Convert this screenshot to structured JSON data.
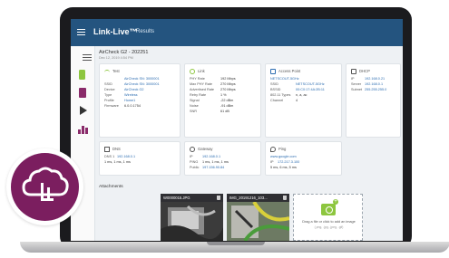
{
  "header": {
    "app_title": "Link-Live™",
    "section": "Results"
  },
  "test": {
    "title": "AirCheck G2 - 202251",
    "date": "Dec 12, 2019 4:54 PM"
  },
  "cards": {
    "test": {
      "title": "Test",
      "rows": [
        {
          "label": "",
          "value": "AirCheck SN: 3000001"
        },
        {
          "label": "SSID",
          "value": "AirCheck SN: 3000001"
        },
        {
          "label": "Device",
          "value": "AirCheck G2"
        },
        {
          "label": "Type",
          "value": "Wireless"
        },
        {
          "label": "Profile",
          "value": "Home1"
        },
        {
          "label": "Firmware",
          "value": "6.0.0.1754"
        }
      ]
    },
    "link": {
      "title": "Link",
      "rows": [
        {
          "label": "PHY Rate",
          "value": "192 Mbps"
        },
        {
          "label": "Max PHY Rate",
          "value": "270 Mbps"
        },
        {
          "label": "Advertised Rate",
          "value": "270 Mbps"
        },
        {
          "label": "Retry Rate",
          "value": "1 %"
        },
        {
          "label": "Signal",
          "value": "-22 dBm"
        },
        {
          "label": "Noise",
          "value": "-91 dBm"
        },
        {
          "label": "SNR",
          "value": "61 dB"
        }
      ]
    },
    "access_point": {
      "title": "Access Point",
      "rows": [
        {
          "label": "",
          "value": "NETSCOUT-5GHz"
        },
        {
          "label": "SSID",
          "value": "NETSCOUT-5GHz"
        },
        {
          "label": "BSSID",
          "value": "00:C0:17:4A:2B:11"
        },
        {
          "label": "802.11 Types",
          "value": "n, a, ac"
        },
        {
          "label": "Channel",
          "value": "4"
        }
      ]
    },
    "dhcp": {
      "title": "DHCP",
      "rows": [
        {
          "label": "IP",
          "value": "192.168.0.21"
        },
        {
          "label": "Server",
          "value": "192.168.0.1"
        },
        {
          "label": "Subnet",
          "value": "255.255.255.0"
        }
      ]
    },
    "dns": {
      "title": "DNS",
      "rows": [
        {
          "label": "DNS 1",
          "value": "192.168.0.1"
        },
        {
          "label": "",
          "value": "1 ms, 1 ms, 1 ms"
        }
      ]
    },
    "gateway": {
      "title": "Gateway",
      "rows": [
        {
          "label": "IP",
          "value": "192.168.0.1"
        },
        {
          "label": "PING",
          "value": "1 ms, 1 ms, 1 ms"
        },
        {
          "label": "Public",
          "value": "197.156.90.84"
        }
      ]
    },
    "ping": {
      "title": "Ping",
      "rows": [
        {
          "label": "",
          "value": "www.google.com"
        },
        {
          "label": "IP",
          "value": "172.217.3.100"
        },
        {
          "label": "",
          "value": "5 ms, 6 ms, 5 ms"
        }
      ]
    }
  },
  "attachments": {
    "title": "Attachments",
    "items": [
      {
        "name": "W0000015.JPG"
      },
      {
        "name": "IMG_20191216_103..."
      }
    ],
    "upload_text": "Drag a file or click to add an image",
    "upload_sub": "(.png, .jpg, .jpeg, .gif)"
  },
  "colors": {
    "header": "#24547f",
    "accent_green": "#8dc63f",
    "brand_purple": "#7b1e5f"
  },
  "icons": [
    "menu-icon",
    "list-icon",
    "phone-icon",
    "document-icon",
    "play-icon",
    "chart-icon",
    "wifi-icon",
    "link-icon",
    "access-point-icon",
    "dhcp-icon",
    "dns-icon",
    "gateway-icon",
    "ping-icon",
    "trash-icon",
    "add-image-icon",
    "cloud-logo-icon"
  ]
}
